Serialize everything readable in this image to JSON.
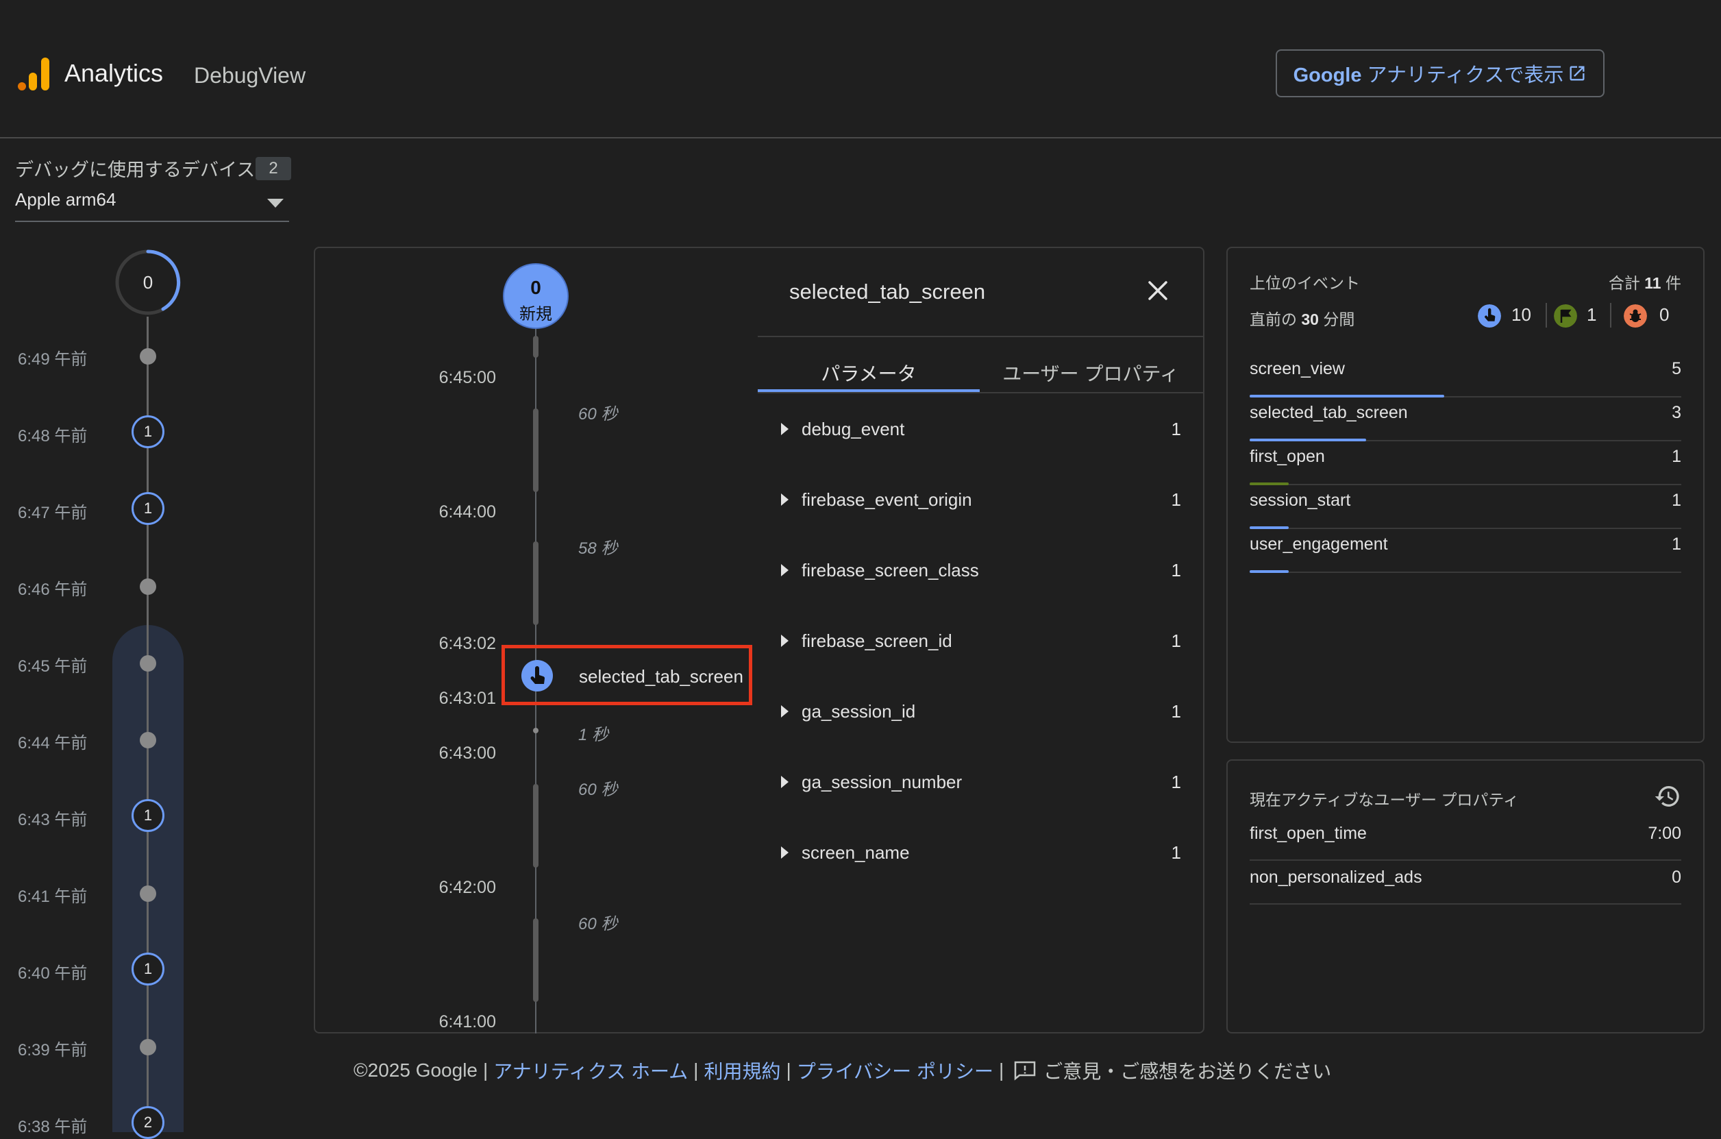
{
  "header": {
    "app_name": "Analytics",
    "view_name": "DebugView",
    "ga_button": {
      "brand": "Google",
      "label": " アナリティクスで表示"
    }
  },
  "device": {
    "label": "デバッグに使用するデバイス",
    "count": "2",
    "selected": "Apple arm64"
  },
  "seconds_stream": {
    "value": "0"
  },
  "minutes_stream": [
    {
      "time": "6:49 午前",
      "count": null
    },
    {
      "time": "6:48 午前",
      "count": "1"
    },
    {
      "time": "6:47 午前",
      "count": "1"
    },
    {
      "time": "6:46 午前",
      "count": null
    },
    {
      "time": "6:45 午前",
      "count": null
    },
    {
      "time": "6:44 午前",
      "count": null
    },
    {
      "time": "6:43 午前",
      "count": "1"
    },
    {
      "time": "6:41 午前",
      "count": null
    },
    {
      "time": "6:40 午前",
      "count": "1"
    },
    {
      "time": "6:39 午前",
      "count": null
    },
    {
      "time": "6:38 午前",
      "count": "2"
    }
  ],
  "timeline": {
    "new_count": "0",
    "new_label": "新規",
    "times": [
      "6:45:00",
      "6:44:00",
      "6:43:02",
      "6:43:01",
      "6:43:00",
      "6:42:00",
      "6:41:00"
    ],
    "durations": [
      "60 秒",
      "58 秒",
      "1 秒",
      "60 秒",
      "60 秒"
    ],
    "event": {
      "name": "selected_tab_screen",
      "icon": "touch-icon"
    }
  },
  "detail": {
    "title": "selected_tab_screen",
    "tabs": [
      "パラメータ",
      "ユーザー プロパティ"
    ],
    "params": [
      {
        "name": "debug_event",
        "value": "1"
      },
      {
        "name": "firebase_event_origin",
        "value": "1"
      },
      {
        "name": "firebase_screen_class",
        "value": "1"
      },
      {
        "name": "firebase_screen_id",
        "value": "1"
      },
      {
        "name": "ga_session_id",
        "value": "1"
      },
      {
        "name": "ga_session_number",
        "value": "1"
      },
      {
        "name": "screen_name",
        "value": "1"
      }
    ]
  },
  "top_events": {
    "title": "上位のイベント",
    "total_prefix": "合計 ",
    "total_count": "11",
    "total_suffix": " 件",
    "period_prefix": "直前の ",
    "period_value": "30",
    "period_suffix": " 分間",
    "counters": {
      "touch": "10",
      "conversion": "1",
      "error": "0"
    },
    "events": [
      {
        "name": "screen_view",
        "count": "5",
        "share": 0.45,
        "color": "#6c9bf5"
      },
      {
        "name": "selected_tab_screen",
        "count": "3",
        "share": 0.27,
        "color": "#6c9bf5"
      },
      {
        "name": "first_open",
        "count": "1",
        "share": 0.09,
        "color": "#5e7d1e"
      },
      {
        "name": "session_start",
        "count": "1",
        "share": 0.09,
        "color": "#6c9bf5"
      },
      {
        "name": "user_engagement",
        "count": "1",
        "share": 0.09,
        "color": "#6c9bf5"
      }
    ]
  },
  "user_properties": {
    "title": "現在アクティブなユーザー プロパティ",
    "items": [
      {
        "name": "first_open_time",
        "value": "7:00"
      },
      {
        "name": "non_personalized_ads",
        "value": "0"
      }
    ]
  },
  "footer": {
    "copyright": "©2025 Google",
    "links": [
      "アナリティクス ホーム",
      "利用規約",
      "プライバシー ポリシー"
    ],
    "feedback": "ご意見・ご感想をお送りください"
  },
  "colors": {
    "accent": "#6c9bf5",
    "link": "#8ab4f8",
    "highlight_border": "#e8361c",
    "conversion": "#5e7d1e",
    "error": "#e8774e",
    "background": "#1f1f1f"
  }
}
